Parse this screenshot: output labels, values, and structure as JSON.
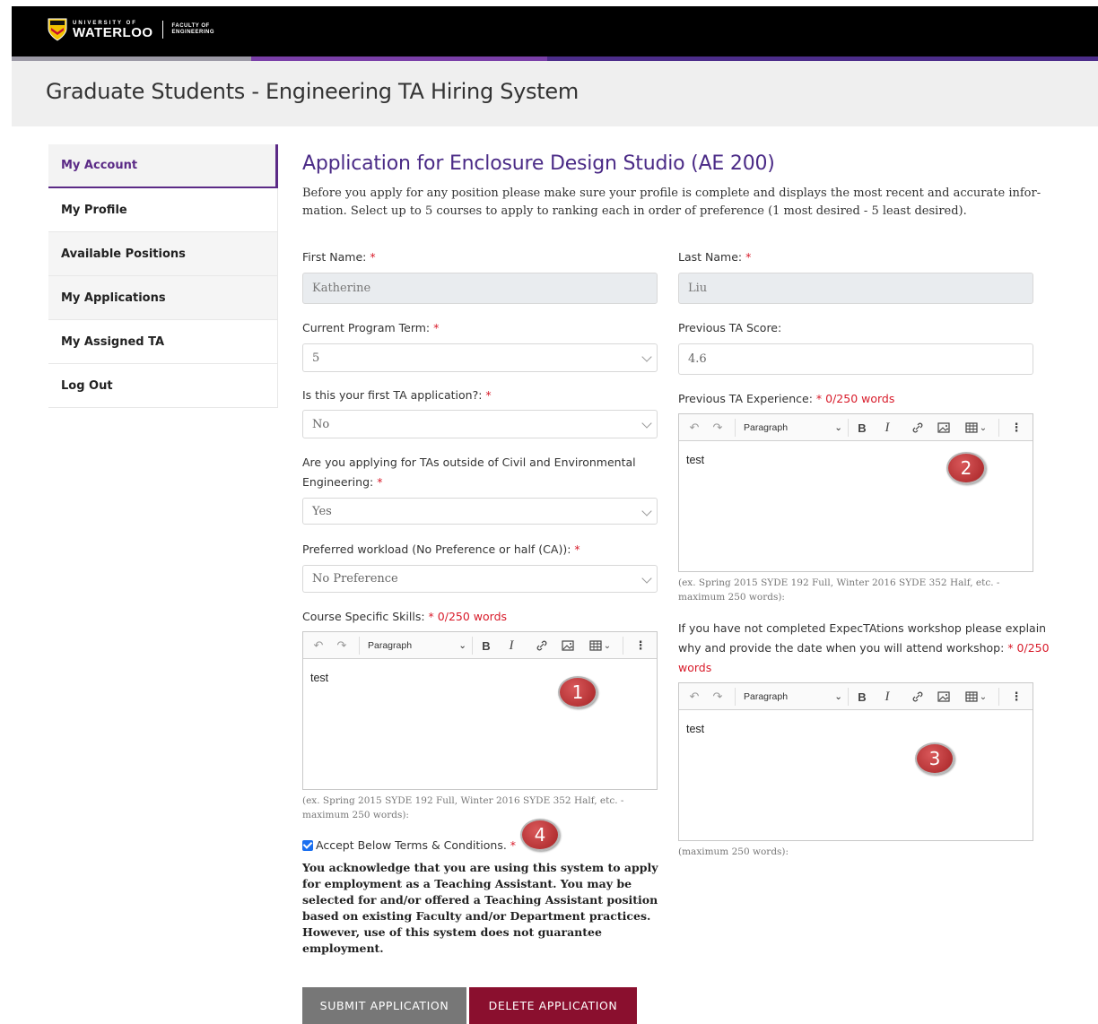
{
  "brand": {
    "university_small": "UNIVERSITY OF",
    "university_big": "WATERLOO",
    "faculty_line1": "FACULTY OF",
    "faculty_line2": "ENGINEERING"
  },
  "header": {
    "title": "Graduate Students - Engineering TA Hiring System"
  },
  "sidebar": {
    "items": [
      {
        "label": "My Account",
        "active": true
      },
      {
        "label": "My Profile"
      },
      {
        "label": "Available Positions"
      },
      {
        "label": "My Applications"
      },
      {
        "label": "My Assigned TA"
      },
      {
        "label": "Log Out"
      }
    ]
  },
  "main": {
    "title": "Application for Enclosure Design Studio (AE 200)",
    "intro": "Before you apply for any position please make sure your profile is complete and displays the most recent and accurate infor-mation. Select up to 5 courses to apply to ranking each in order of preference (1 most desired - 5 least desired)."
  },
  "form": {
    "first_name": {
      "label": "First Name:",
      "value": "Katherine"
    },
    "last_name": {
      "label": "Last Name:",
      "value": "Liu"
    },
    "program_term": {
      "label": "Current Program Term:",
      "value": "5"
    },
    "prev_ta_score": {
      "label": "Previous TA Score:",
      "value": "4.6"
    },
    "first_app": {
      "label": "Is this your first TA application?:",
      "value": "No"
    },
    "outside": {
      "label_line1": "Are you applying for TAs outside of Civil and Environmental",
      "label_line2": "Engineering:",
      "value": "Yes"
    },
    "workload": {
      "label": "Preferred workload (No Preference or half (CA)):",
      "value": "No Preference"
    },
    "course_skills": {
      "label": "Course Specific Skills:",
      "counter": "0/250 words",
      "content": "test",
      "hint_line1": "(ex. Spring 2015 SYDE 192 Full, Winter 2016 SYDE 352 Half, etc. -",
      "hint_line2": "maximum 250 words):"
    },
    "prev_ta_exp": {
      "label": "Previous TA Experience:",
      "counter": "0/250 words",
      "content": "test",
      "hint_line1": "(ex. Spring 2015 SYDE 192 Full, Winter 2016 SYDE 352 Half, etc. -",
      "hint_line2": "maximum 250 words):"
    },
    "workshop": {
      "label_line1": "If you have not completed ExpecTAtions workshop please explain",
      "label_line2": "why and provide the date when you will attend workshop:",
      "counter_a": "0/250",
      "counter_b": "words",
      "content": "test",
      "hint": "(maximum 250 words):"
    },
    "required_mark": "*",
    "terms_label": "Accept Below Terms & Conditions.",
    "terms_text": "You acknowledge that you are using this system to apply for employment as a Teaching Assistant. You may be selected for and/or offered a Teaching Assistant position based on existing Faculty and/or Department practices. However, use of this system does not guarantee employment."
  },
  "editor_toolbar": {
    "paragraph": "Paragraph",
    "bold": "B",
    "italic": "I"
  },
  "markers": [
    "1",
    "2",
    "3",
    "4"
  ],
  "buttons": {
    "submit": "SUBMIT APPLICATION",
    "delete": "DELETE APPLICATION"
  },
  "colors": {
    "accent": "#4a2a86",
    "required": "#d81b2a",
    "delete": "#8a0f2e",
    "submit": "#777777"
  }
}
